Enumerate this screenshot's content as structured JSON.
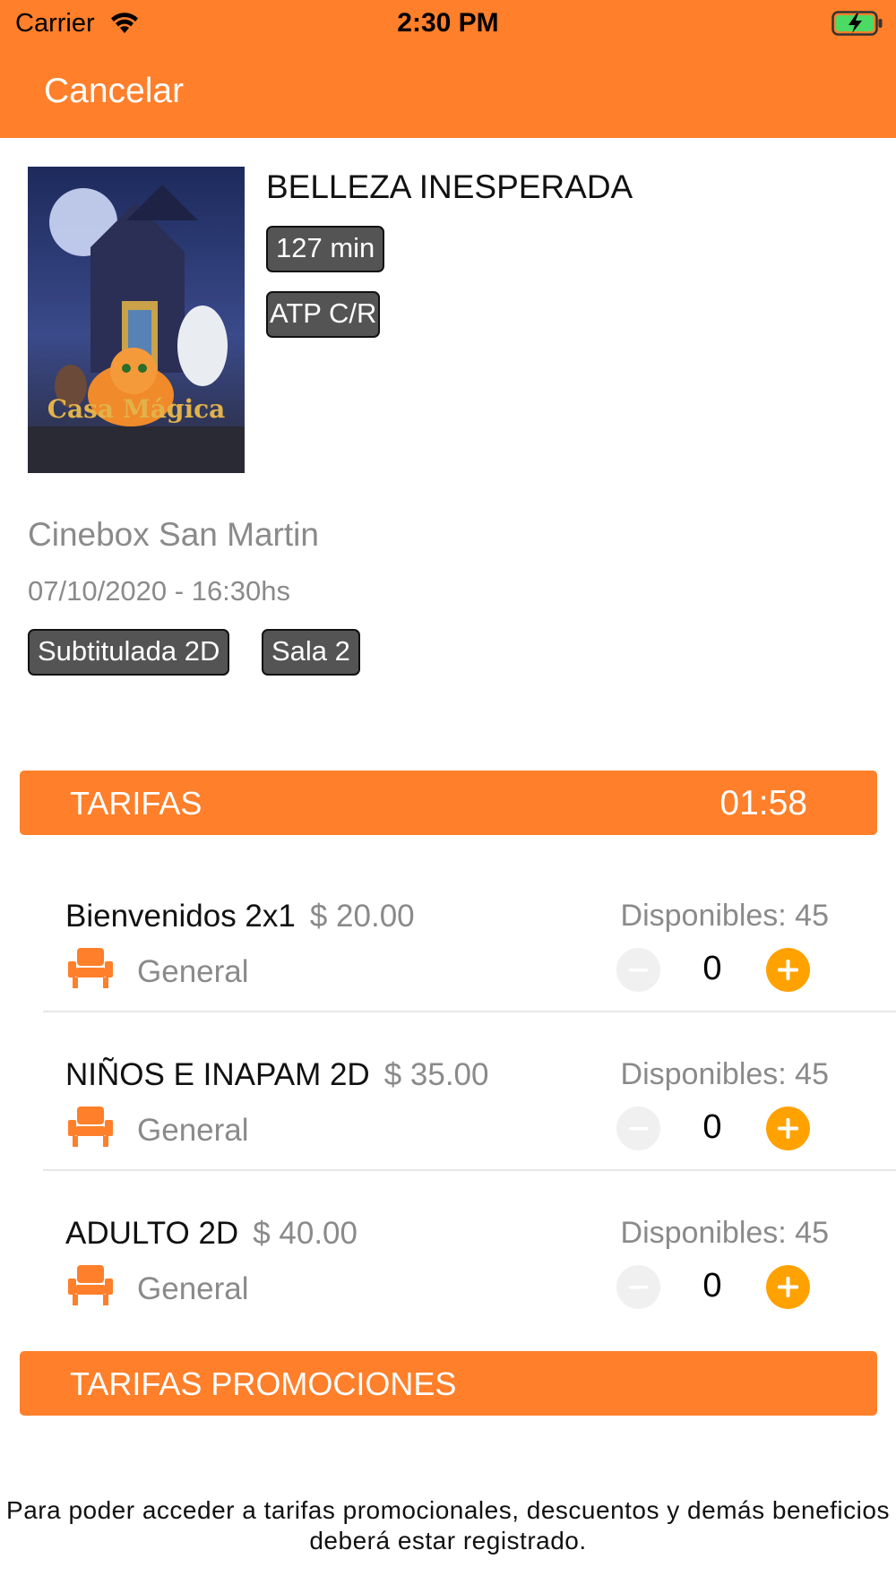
{
  "status_bar": {
    "carrier": "Carrier",
    "time": "2:30 PM"
  },
  "nav": {
    "cancel_label": "Cancelar"
  },
  "colors": {
    "accent": "#FF7F2A",
    "plus_button": "#FFA200",
    "badge_bg": "#545454"
  },
  "movie": {
    "title": "BELLEZA INESPERADA",
    "duration": "127 min",
    "rating": "ATP C/R",
    "poster_title": "Casa Mágica"
  },
  "showtime": {
    "cinema": "Cinebox San Martin",
    "datetime": "07/10/2020 - 16:30hs",
    "format": "Subtitulada 2D",
    "room": "Sala 2"
  },
  "tarifas": {
    "header": "TARIFAS",
    "timer": "01:58",
    "items": [
      {
        "name": "Bienvenidos 2x1",
        "price": "$ 20.00",
        "available": "Disponibles: 45",
        "seat_type": "General",
        "quantity": "0"
      },
      {
        "name": "NIÑOS E INAPAM 2D",
        "price": "$ 35.00",
        "available": "Disponibles: 45",
        "seat_type": "General",
        "quantity": "0"
      },
      {
        "name": "ADULTO 2D",
        "price": "$ 40.00",
        "available": "Disponibles: 45",
        "seat_type": "General",
        "quantity": "0"
      }
    ]
  },
  "promociones": {
    "header": "TARIFAS PROMOCIONES",
    "notice": "Para poder acceder a tarifas promocionales, descuentos y demás beneficios deberá estar registrado."
  },
  "icons": {
    "wifi": "wifi-icon",
    "battery": "battery-charging-icon",
    "seat": "seat-icon",
    "minus": "minus-icon",
    "plus": "plus-icon"
  }
}
